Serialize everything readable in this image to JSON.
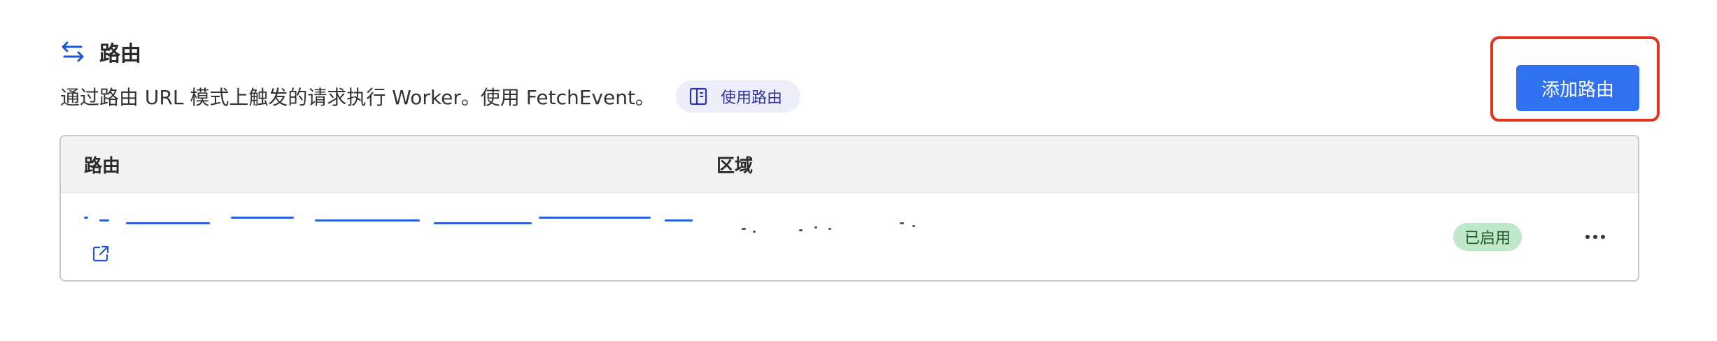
{
  "section": {
    "icon": "swap-arrows-icon",
    "title": "路由",
    "description": "通过路由 URL 模式上触发的请求执行 Worker。使用 FetchEvent。",
    "docs_link": {
      "icon": "book-icon",
      "label": "使用路由"
    },
    "add_button_label": "添加路由"
  },
  "table": {
    "columns": [
      "路由",
      "区域"
    ],
    "rows": [
      {
        "route": "",
        "zone": "",
        "status": "已启用",
        "link_icon": "external-link-icon",
        "menu_icon": "more-horizontal-icon"
      }
    ]
  },
  "colors": {
    "accent": "#2f71f0",
    "highlight_border": "#e0341f",
    "status_badge_bg": "#bfe8c8",
    "docs_pill_bg": "#eeeefb",
    "link": "#1f55d8"
  }
}
